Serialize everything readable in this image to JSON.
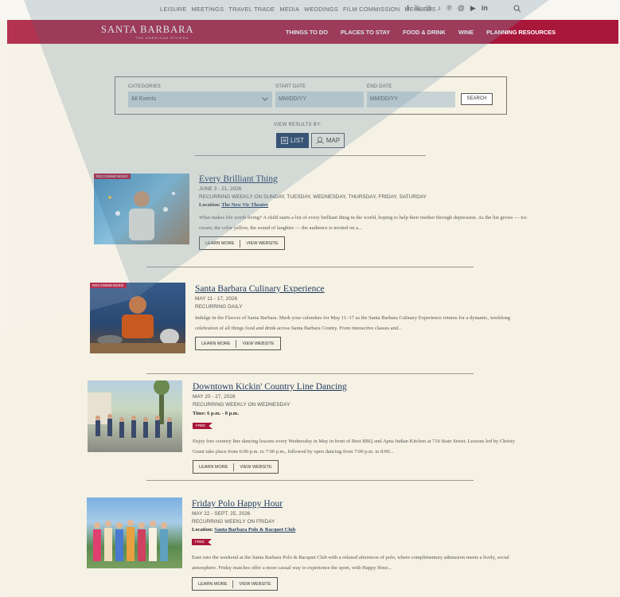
{
  "utility_nav": [
    "LEISURE",
    "MEETINGS",
    "TRAVEL TRADE",
    "MEDIA",
    "WEDDINGS",
    "FILM COMMISSION",
    "MEMBERS"
  ],
  "social_icons": [
    "facebook-icon",
    "x-icon",
    "instagram-icon",
    "tiktok-icon",
    "pinterest-icon",
    "threads-icon",
    "youtube-icon",
    "linkedin-icon"
  ],
  "logo": {
    "name": "SANTA BARBARA",
    "tagline": "THE AMERICAN RIVIERA"
  },
  "main_nav": [
    "THINGS TO DO",
    "PLACES TO STAY",
    "FOOD & DRINK",
    "WINE",
    "PLANNING RESOURCES"
  ],
  "filter": {
    "categories_label": "CATEGORIES",
    "categories_value": "All Events",
    "start_label": "START DATE",
    "start_placeholder": "MM/DD/YY",
    "end_label": "END DATE",
    "end_placeholder": "MM/DD/YY",
    "search_label": "SEARCH"
  },
  "view": {
    "label": "VIEW RESULTS BY:",
    "list": "LIST",
    "map": "MAP"
  },
  "events": [
    {
      "badge": "RECOMMENDED",
      "title": "Every Brilliant Thing",
      "dates": "JUNE 3 - 21, 2026",
      "recurrence": "RECURRING WEEKLY ON SUNDAY, TUESDAY, WEDNESDAY, THURSDAY, FRIDAY, SATURDAY",
      "loc_label": "Location:",
      "loc_value": "The New Vic Theater",
      "desc": "What makes life worth living? A child starts a list of every brilliant thing in the world, hoping to help their mother through depression. As the list grows — ice cream, the color yellow, the sound of laughter — the audience is invited on a...",
      "learn": "LEARN MORE",
      "website": "VIEW WEBSITE"
    },
    {
      "badge": "RECOMMENDED",
      "title": "Santa Barbara Culinary Experience",
      "dates": "MAY 11 - 17, 2026",
      "recurrence": "RECURRING DAILY",
      "desc": "Indulge in the Flavors of Santa Barbara. Mark your calendars for May 11–17 as the Santa Barbara Culinary Experience returns for a dynamic, weeklong celebration of all things food and drink across Santa Barbara County. From interactive classes and...",
      "learn": "LEARN MORE",
      "website": "VIEW WEBSITE"
    },
    {
      "title": "Downtown Kickin' Country Line Dancing",
      "dates": "MAY 20 - 27, 2026",
      "recurrence": "RECURRING WEEKLY ON WEDNESDAY",
      "loc_label": "Time:",
      "loc_value": "6 p.m. - 8 p.m.",
      "tag": "FREE",
      "desc": "Enjoy free country line dancing lessons every Wednesday in May in front of Best BBQ and Apna Indian Kitchen at 716 State Street. Lessons led by Christy Grant take place from 6:00 p.m. to 7:00 p.m., followed by open dancing from 7:00 p.m. to 8:00...",
      "learn": "LEARN MORE",
      "website": "VIEW WEBSITE"
    },
    {
      "title": "Friday Polo Happy Hour",
      "dates": "MAY 22 - SEPT. 25, 2026",
      "recurrence": "RECURRING WEEKLY ON FRIDAY",
      "loc_label": "Location:",
      "loc_value": "Santa Barbara Polo & Racquet Club",
      "tag": "FREE",
      "desc": "Ease into the weekend at the Santa Barbara Polo & Racquet Club with a relaxed afternoon of polo, where complimentary admission meets a lively, social atmosphere. Friday matches offer a more casual way to experience the sport, with Happy Hour...",
      "learn": "LEARN MORE",
      "website": "VIEW WEBSITE"
    }
  ]
}
